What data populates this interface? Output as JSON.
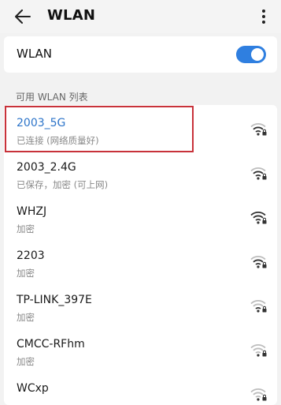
{
  "header": {
    "title": "WLAN",
    "back_icon": "arrow-left-icon",
    "more_icon": "more-vertical-icon"
  },
  "wlan_toggle": {
    "label": "WLAN",
    "enabled": true,
    "accent_color": "#2f7fe0"
  },
  "available": {
    "section_title": "可用 WLAN 列表",
    "networks": [
      {
        "name": "2003_5G",
        "status": "已连接 (网络质量好)",
        "connected": true,
        "secured": true,
        "signal": "strong"
      },
      {
        "name": "2003_2.4G",
        "status": "已保存，加密 (可上网)",
        "connected": false,
        "secured": true,
        "signal": "strong"
      },
      {
        "name": "WHZJ",
        "status": "加密",
        "connected": false,
        "secured": true,
        "signal": "full"
      },
      {
        "name": "2203",
        "status": "加密",
        "connected": false,
        "secured": true,
        "signal": "strong"
      },
      {
        "name": "TP-LINK_397E",
        "status": "加密",
        "connected": false,
        "secured": true,
        "signal": "medium"
      },
      {
        "name": "CMCC-RFhm",
        "status": "加密",
        "connected": false,
        "secured": true,
        "signal": "weak"
      },
      {
        "name": "WCxp",
        "status": "",
        "connected": false,
        "secured": true,
        "signal": "weak"
      }
    ]
  },
  "annotation": {
    "highlight_color": "#c8323a"
  }
}
